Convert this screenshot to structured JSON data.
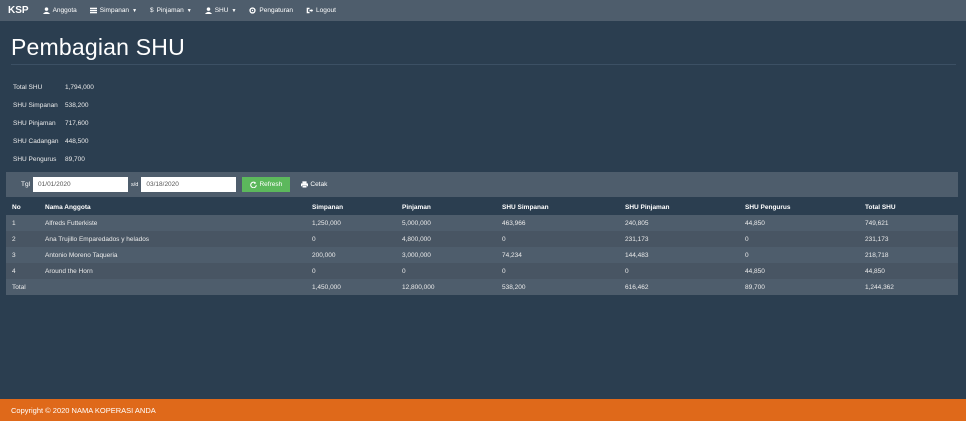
{
  "nav": {
    "brand": "KSP",
    "items": [
      {
        "label": "Anggota",
        "icon": "user-icon",
        "dropdown": false
      },
      {
        "label": "Simpanan",
        "icon": "list-icon",
        "dropdown": true
      },
      {
        "label": "Pinjaman",
        "icon": "dollar-icon",
        "dropdown": true
      },
      {
        "label": "SHU",
        "icon": "user-icon",
        "dropdown": true
      },
      {
        "label": "Pengaturan",
        "icon": "gear-icon",
        "dropdown": false
      },
      {
        "label": "Logout",
        "icon": "logout-icon",
        "dropdown": false
      }
    ]
  },
  "page": {
    "title": "Pembagian SHU"
  },
  "summary": {
    "total_shu_label": "Total SHU",
    "total_shu_value": "1,794,000",
    "shu_simpanan_label": "SHU Simpanan",
    "shu_simpanan_value": "538,200",
    "shu_pinjaman_label": "SHU Pinjaman",
    "shu_pinjaman_value": "717,600",
    "shu_cadangan_label": "SHU Cadangan",
    "shu_cadangan_value": "448,500",
    "shu_pengurus_label": "SHU Pengurus",
    "shu_pengurus_value": "89,700"
  },
  "filter": {
    "tgl_label": "Tgl",
    "date_from": "01/01/2020",
    "sd_label": "s/d",
    "date_to": "03/18/2020",
    "refresh_label": "Refresh",
    "cetak_label": "Cetak"
  },
  "table": {
    "columns": [
      "No",
      "Nama Anggota",
      "Simpanan",
      "Pinjaman",
      "SHU Simpanan",
      "SHU Pinjaman",
      "SHU Pengurus",
      "Total SHU"
    ],
    "rows": [
      [
        "1",
        "Alfreds Futterkiste",
        "1,250,000",
        "5,000,000",
        "463,966",
        "240,805",
        "44,850",
        "749,621"
      ],
      [
        "2",
        "Ana Trujillo Emparedados y helados",
        "0",
        "4,800,000",
        "0",
        "231,173",
        "0",
        "231,173"
      ],
      [
        "3",
        "Antonio Moreno Taqueria",
        "200,000",
        "3,000,000",
        "74,234",
        "144,483",
        "0",
        "218,718"
      ],
      [
        "4",
        "Around the Horn",
        "0",
        "0",
        "0",
        "0",
        "44,850",
        "44,850"
      ]
    ],
    "total": [
      "Total",
      "",
      "1,450,000",
      "12,800,000",
      "538,200",
      "616,462",
      "89,700",
      "1,244,362"
    ]
  },
  "footer": {
    "text": "Copyright © 2020 NAMA KOPERASI ANDA"
  },
  "colors": {
    "navbar": "#4e5d6c",
    "background": "#2b3e50",
    "footer": "#df691a",
    "refresh": "#5cb85c"
  }
}
